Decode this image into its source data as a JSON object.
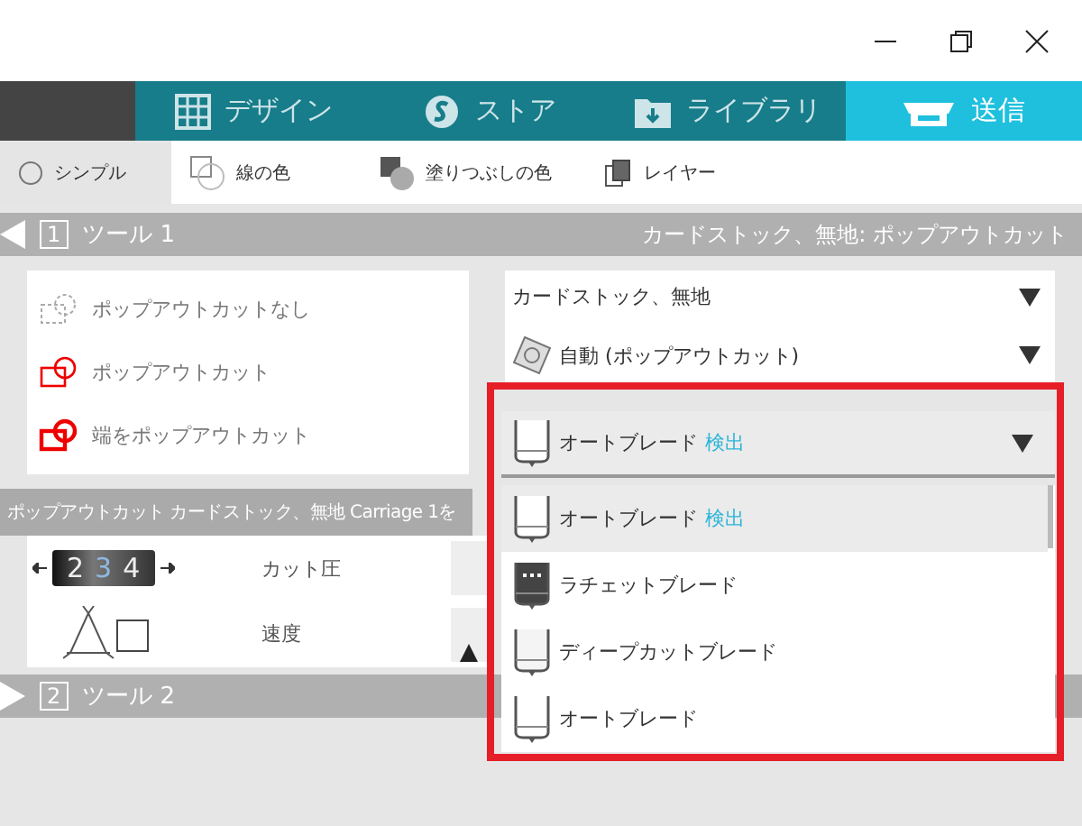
{
  "nav_tabs": [
    {
      "label": "デザイン",
      "kind": "grid",
      "selected": false
    },
    {
      "label": "ストア",
      "kind": "store",
      "selected": false
    },
    {
      "label": "ライブラリ",
      "kind": "folder",
      "selected": false
    },
    {
      "label": "送信",
      "kind": "send",
      "selected": true
    }
  ],
  "toolbar": [
    {
      "label": "シンプル",
      "kind": "simple",
      "selected": true
    },
    {
      "label": "線の色",
      "kind": "line",
      "selected": false
    },
    {
      "label": "塗りつぶしの色",
      "kind": "fill",
      "selected": false
    },
    {
      "label": "レイヤー",
      "kind": "layer",
      "selected": false
    }
  ],
  "tool_1": {
    "number": "1",
    "label": "ツール 1",
    "summary": "カードストック、無地: ポップアウトカット",
    "expanded": true
  },
  "popout_options": [
    {
      "label": "ポップアウトカットなし",
      "kind": "none"
    },
    {
      "label": "ポップアウトカット",
      "kind": "popout"
    },
    {
      "label": "端をポップアウトカット",
      "kind": "edge"
    }
  ],
  "status_text": "ポップアウトカット カードストック、無地 Carriage 1を",
  "dial": {
    "digits": [
      {
        "text": "2",
        "selected": false
      },
      {
        "text": "3",
        "selected": true
      },
      {
        "text": "4",
        "selected": false
      }
    ]
  },
  "settings": [
    {
      "label": "カット圧"
    },
    {
      "label": "速度"
    }
  ],
  "material": {
    "value": "カードストック、無地"
  },
  "mat": {
    "value": "自動 (ポップアウトカット)"
  },
  "blade_dropdown": {
    "value": "オートブレード",
    "badge": "検出",
    "kind": "auto",
    "highlighted": true
  },
  "blade_options": [
    {
      "label": "オートブレード",
      "badge": "検出",
      "kind": "auto",
      "selected": true
    },
    {
      "label": "ラチェットブレード",
      "kind": "ratchet",
      "selected": false
    },
    {
      "label": "ディープカットブレード",
      "kind": "deep",
      "selected": false
    },
    {
      "label": "オートブレード",
      "kind": "auto",
      "selected": false
    }
  ],
  "tool_2": {
    "number": "2",
    "label": "ツール 2",
    "expanded": false
  }
}
